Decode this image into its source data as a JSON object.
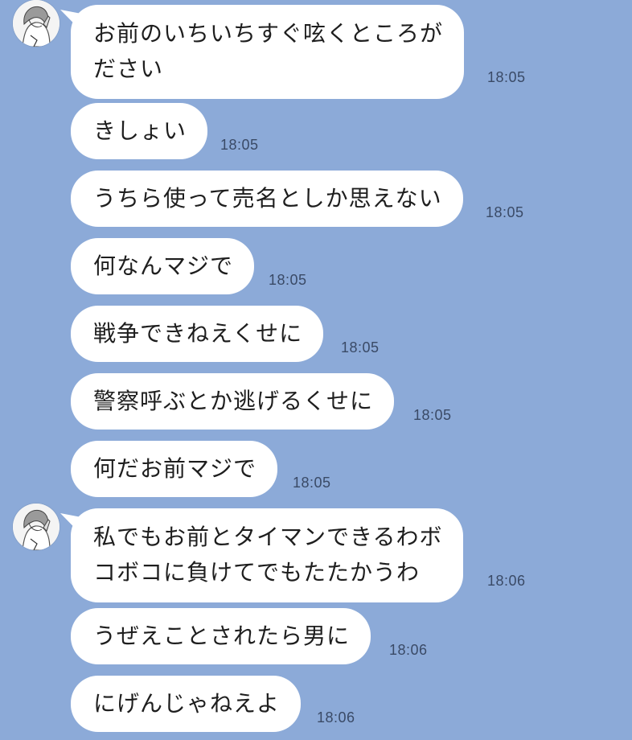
{
  "messages": [
    {
      "lines": [
        "お前のいちいちすぐ呟くところが",
        "ださい"
      ],
      "time": "18:05",
      "has_avatar": true
    },
    {
      "lines": [
        "きしょい"
      ],
      "time": "18:05"
    },
    {
      "lines": [
        "うちら使って売名としか思えない"
      ],
      "time": "18:05"
    },
    {
      "lines": [
        "何なんマジで"
      ],
      "time": "18:05"
    },
    {
      "lines": [
        "戦争できねえくせに"
      ],
      "time": "18:05"
    },
    {
      "lines": [
        "警察呼ぶとか逃げるくせに"
      ],
      "time": "18:05"
    },
    {
      "lines": [
        "何だお前マジで"
      ],
      "time": "18:05"
    },
    {
      "lines": [
        "私でもお前とタイマンできるわボ",
        "コボコに負けてでもたたかうわ"
      ],
      "time": "18:06",
      "has_avatar": true
    },
    {
      "lines": [
        "うぜえことされたら男に"
      ],
      "time": "18:06"
    },
    {
      "lines": [
        "にげんじゃねえよ"
      ],
      "time": "18:06"
    }
  ],
  "colors": {
    "background": "#8caad8",
    "bubble": "#ffffff",
    "text": "#1e1e1e",
    "time": "#3a4a66"
  },
  "icons": {
    "avatar": "sender-avatar-illustration"
  }
}
